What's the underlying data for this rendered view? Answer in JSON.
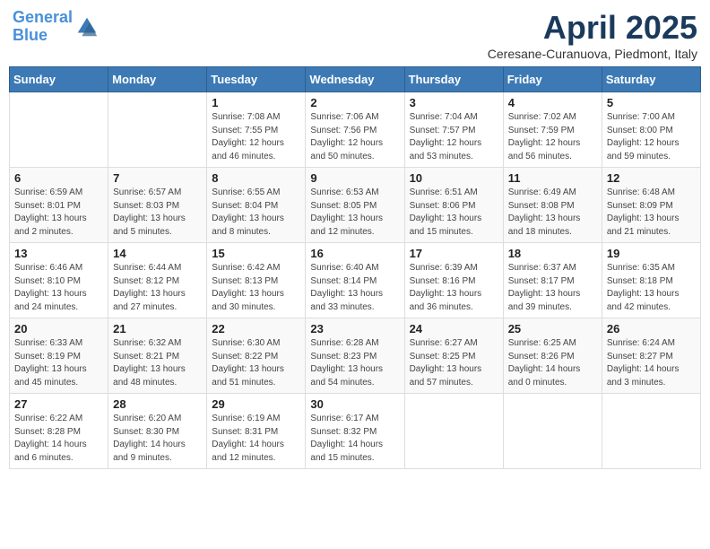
{
  "header": {
    "logo_line1": "General",
    "logo_line2": "Blue",
    "month": "April 2025",
    "location": "Ceresane-Curanuova, Piedmont, Italy"
  },
  "weekdays": [
    "Sunday",
    "Monday",
    "Tuesday",
    "Wednesday",
    "Thursday",
    "Friday",
    "Saturday"
  ],
  "weeks": [
    [
      {
        "day": "",
        "info": ""
      },
      {
        "day": "",
        "info": ""
      },
      {
        "day": "1",
        "info": "Sunrise: 7:08 AM\nSunset: 7:55 PM\nDaylight: 12 hours\nand 46 minutes."
      },
      {
        "day": "2",
        "info": "Sunrise: 7:06 AM\nSunset: 7:56 PM\nDaylight: 12 hours\nand 50 minutes."
      },
      {
        "day": "3",
        "info": "Sunrise: 7:04 AM\nSunset: 7:57 PM\nDaylight: 12 hours\nand 53 minutes."
      },
      {
        "day": "4",
        "info": "Sunrise: 7:02 AM\nSunset: 7:59 PM\nDaylight: 12 hours\nand 56 minutes."
      },
      {
        "day": "5",
        "info": "Sunrise: 7:00 AM\nSunset: 8:00 PM\nDaylight: 12 hours\nand 59 minutes."
      }
    ],
    [
      {
        "day": "6",
        "info": "Sunrise: 6:59 AM\nSunset: 8:01 PM\nDaylight: 13 hours\nand 2 minutes."
      },
      {
        "day": "7",
        "info": "Sunrise: 6:57 AM\nSunset: 8:03 PM\nDaylight: 13 hours\nand 5 minutes."
      },
      {
        "day": "8",
        "info": "Sunrise: 6:55 AM\nSunset: 8:04 PM\nDaylight: 13 hours\nand 8 minutes."
      },
      {
        "day": "9",
        "info": "Sunrise: 6:53 AM\nSunset: 8:05 PM\nDaylight: 13 hours\nand 12 minutes."
      },
      {
        "day": "10",
        "info": "Sunrise: 6:51 AM\nSunset: 8:06 PM\nDaylight: 13 hours\nand 15 minutes."
      },
      {
        "day": "11",
        "info": "Sunrise: 6:49 AM\nSunset: 8:08 PM\nDaylight: 13 hours\nand 18 minutes."
      },
      {
        "day": "12",
        "info": "Sunrise: 6:48 AM\nSunset: 8:09 PM\nDaylight: 13 hours\nand 21 minutes."
      }
    ],
    [
      {
        "day": "13",
        "info": "Sunrise: 6:46 AM\nSunset: 8:10 PM\nDaylight: 13 hours\nand 24 minutes."
      },
      {
        "day": "14",
        "info": "Sunrise: 6:44 AM\nSunset: 8:12 PM\nDaylight: 13 hours\nand 27 minutes."
      },
      {
        "day": "15",
        "info": "Sunrise: 6:42 AM\nSunset: 8:13 PM\nDaylight: 13 hours\nand 30 minutes."
      },
      {
        "day": "16",
        "info": "Sunrise: 6:40 AM\nSunset: 8:14 PM\nDaylight: 13 hours\nand 33 minutes."
      },
      {
        "day": "17",
        "info": "Sunrise: 6:39 AM\nSunset: 8:16 PM\nDaylight: 13 hours\nand 36 minutes."
      },
      {
        "day": "18",
        "info": "Sunrise: 6:37 AM\nSunset: 8:17 PM\nDaylight: 13 hours\nand 39 minutes."
      },
      {
        "day": "19",
        "info": "Sunrise: 6:35 AM\nSunset: 8:18 PM\nDaylight: 13 hours\nand 42 minutes."
      }
    ],
    [
      {
        "day": "20",
        "info": "Sunrise: 6:33 AM\nSunset: 8:19 PM\nDaylight: 13 hours\nand 45 minutes."
      },
      {
        "day": "21",
        "info": "Sunrise: 6:32 AM\nSunset: 8:21 PM\nDaylight: 13 hours\nand 48 minutes."
      },
      {
        "day": "22",
        "info": "Sunrise: 6:30 AM\nSunset: 8:22 PM\nDaylight: 13 hours\nand 51 minutes."
      },
      {
        "day": "23",
        "info": "Sunrise: 6:28 AM\nSunset: 8:23 PM\nDaylight: 13 hours\nand 54 minutes."
      },
      {
        "day": "24",
        "info": "Sunrise: 6:27 AM\nSunset: 8:25 PM\nDaylight: 13 hours\nand 57 minutes."
      },
      {
        "day": "25",
        "info": "Sunrise: 6:25 AM\nSunset: 8:26 PM\nDaylight: 14 hours\nand 0 minutes."
      },
      {
        "day": "26",
        "info": "Sunrise: 6:24 AM\nSunset: 8:27 PM\nDaylight: 14 hours\nand 3 minutes."
      }
    ],
    [
      {
        "day": "27",
        "info": "Sunrise: 6:22 AM\nSunset: 8:28 PM\nDaylight: 14 hours\nand 6 minutes."
      },
      {
        "day": "28",
        "info": "Sunrise: 6:20 AM\nSunset: 8:30 PM\nDaylight: 14 hours\nand 9 minutes."
      },
      {
        "day": "29",
        "info": "Sunrise: 6:19 AM\nSunset: 8:31 PM\nDaylight: 14 hours\nand 12 minutes."
      },
      {
        "day": "30",
        "info": "Sunrise: 6:17 AM\nSunset: 8:32 PM\nDaylight: 14 hours\nand 15 minutes."
      },
      {
        "day": "",
        "info": ""
      },
      {
        "day": "",
        "info": ""
      },
      {
        "day": "",
        "info": ""
      }
    ]
  ]
}
